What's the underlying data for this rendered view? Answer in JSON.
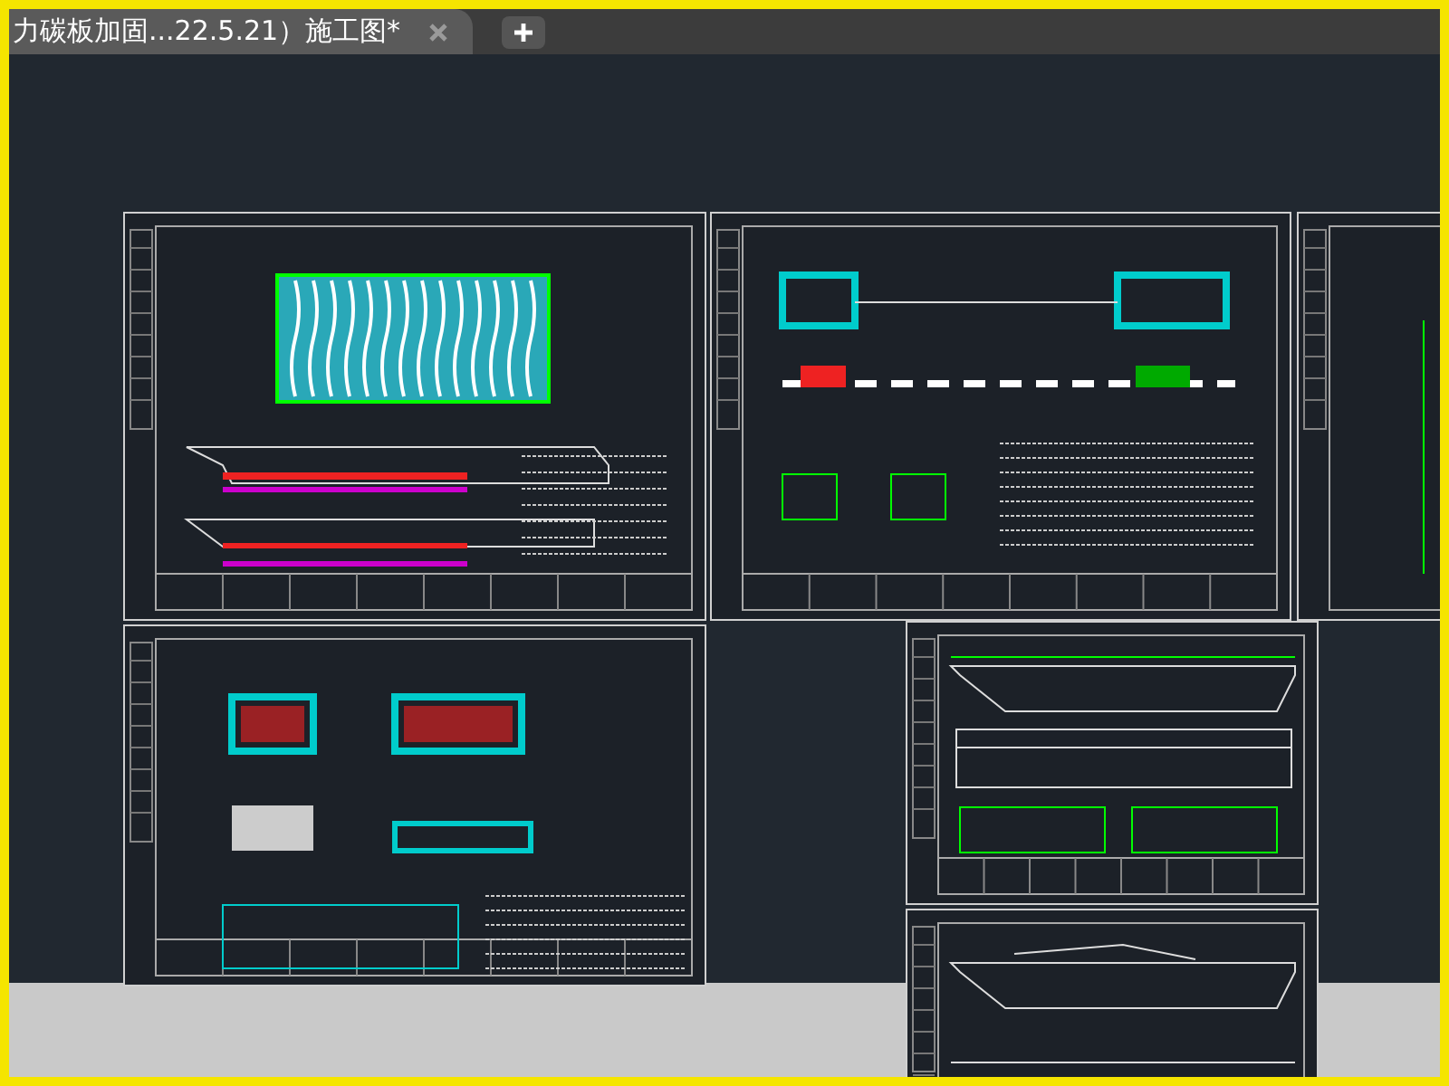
{
  "tabs": [
    {
      "title": "力碳板加固...22.5.21）施工图*",
      "selected": true
    }
  ]
}
